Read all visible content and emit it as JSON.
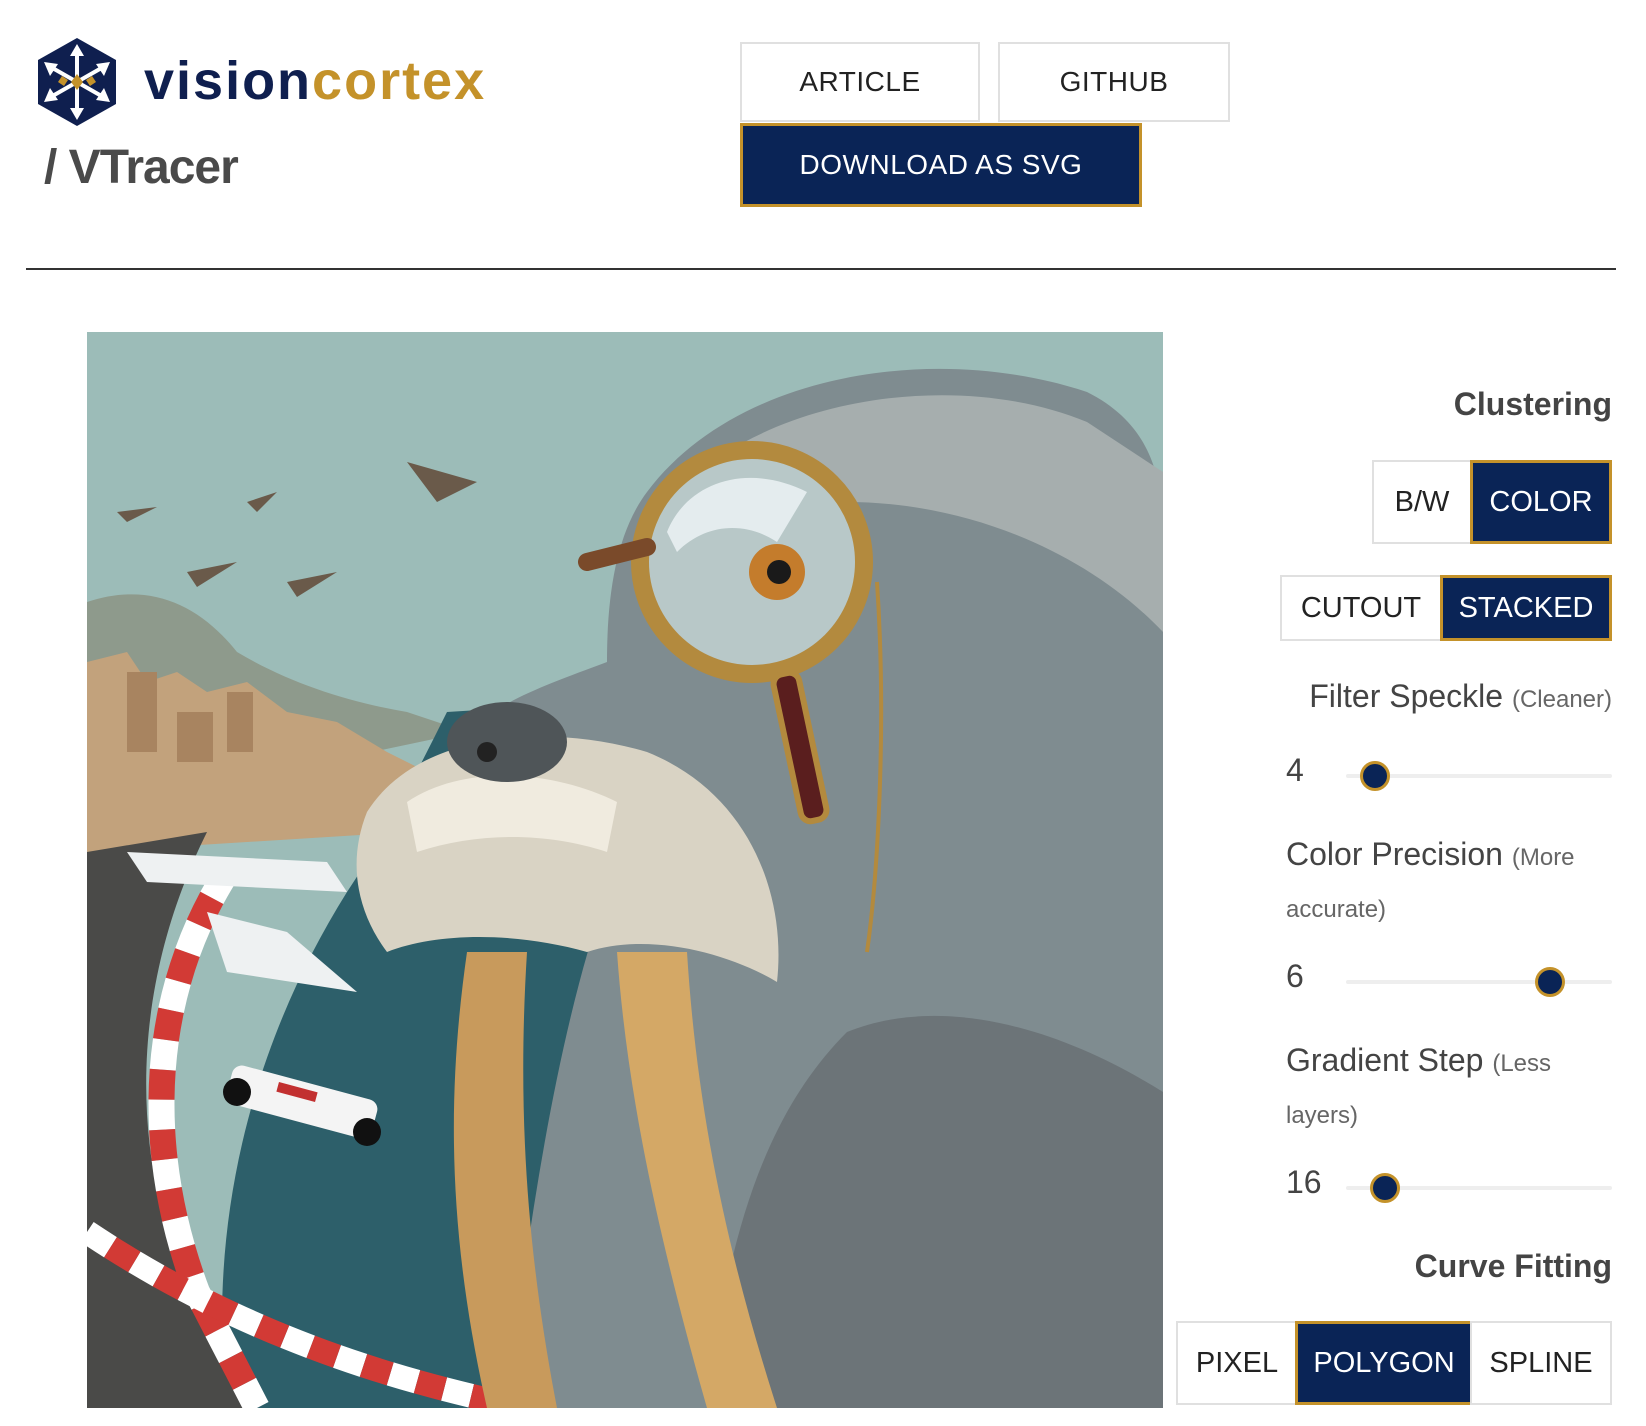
{
  "brand": {
    "name_part1": "vision",
    "name_part2": "cortex",
    "product": "/ VTracer",
    "colors": {
      "navy": "#0f1f4f",
      "gold": "#c4922a"
    },
    "logo_icon": "snowflake-hexagon-logo"
  },
  "header": {
    "article_label": "ARTICLE",
    "github_label": "GITHUB",
    "download_label": "DOWNLOAD AS SVG"
  },
  "preview": {
    "description_icon": "vectorized-image-preview"
  },
  "controls": {
    "clustering": {
      "title": "Clustering",
      "mode_options": [
        "B/W",
        "COLOR"
      ],
      "mode_selected": "COLOR",
      "layer_options": [
        "CUTOUT",
        "STACKED"
      ],
      "layer_selected": "STACKED"
    },
    "filter_speckle": {
      "label": "Filter Speckle",
      "hint": "(Cleaner)",
      "value": "4",
      "fraction": 0.06
    },
    "color_precision": {
      "label": "Color Precision",
      "hint": "(More accurate)",
      "value": "6",
      "fraction": 0.8
    },
    "gradient_step": {
      "label": "Gradient Step",
      "hint": "(Less layers)",
      "value": "16",
      "fraction": 0.1
    },
    "curve_fitting": {
      "title": "Curve Fitting",
      "options": [
        "PIXEL",
        "POLYGON",
        "SPLINE"
      ],
      "selected": "POLYGON"
    }
  }
}
